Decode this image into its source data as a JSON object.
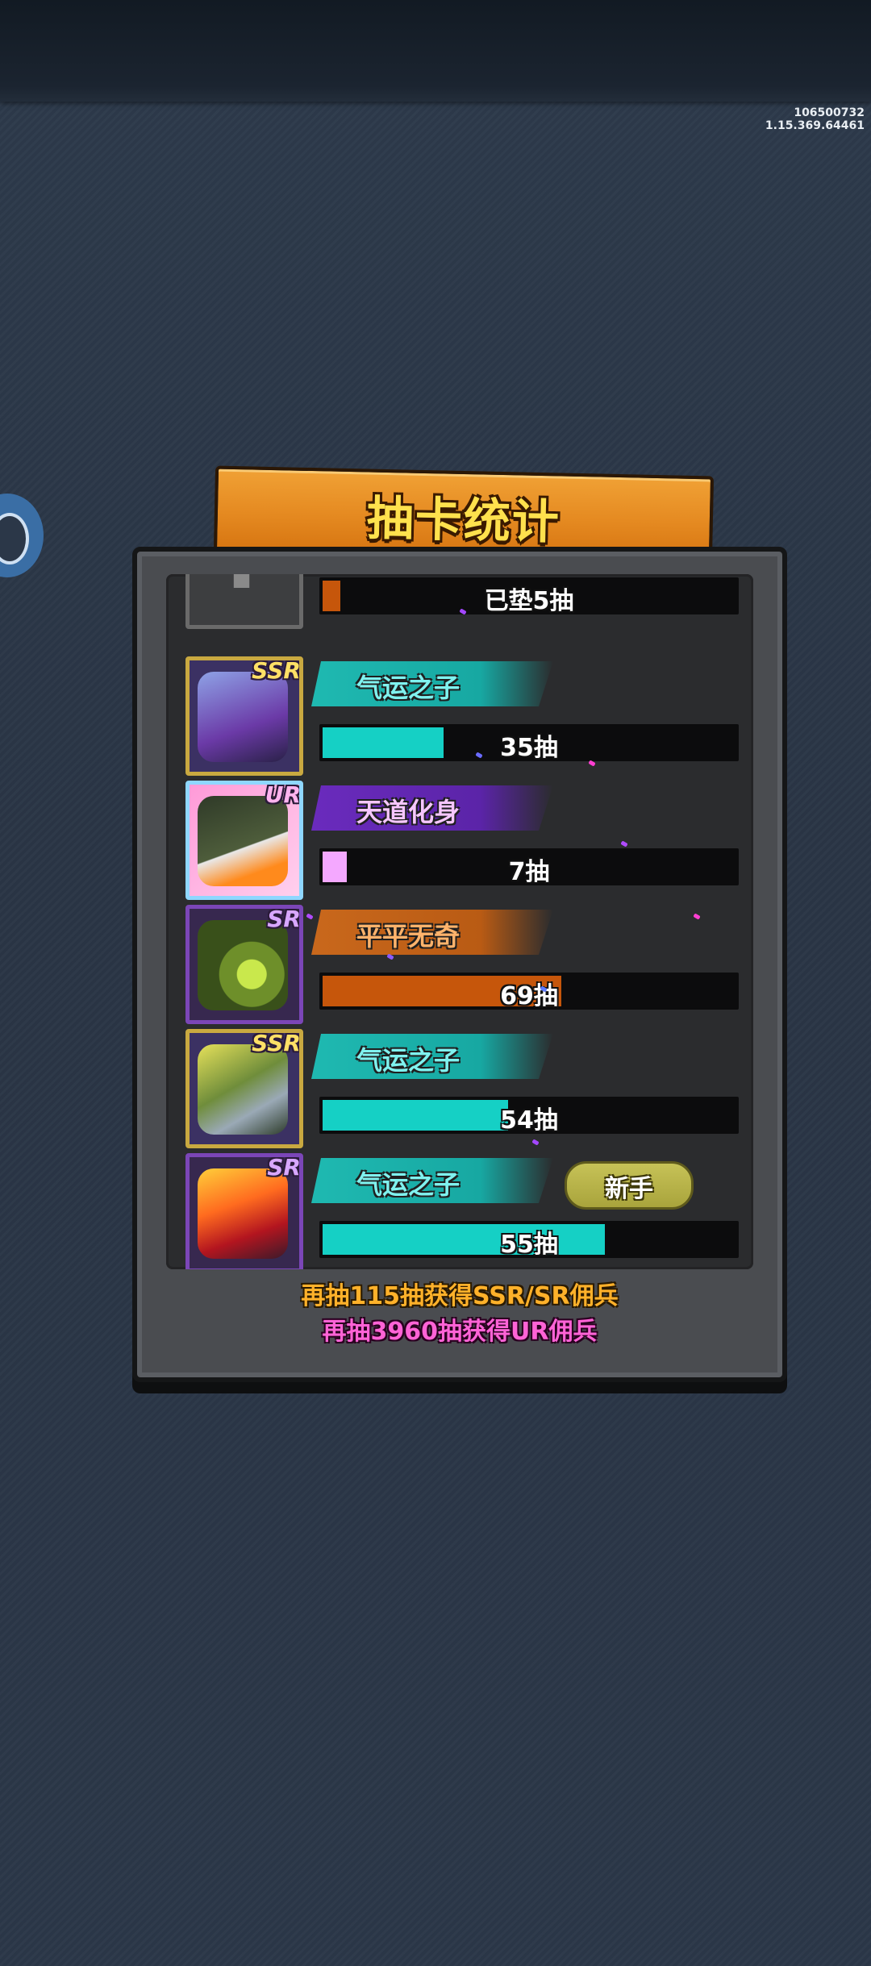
{
  "version": {
    "build": "106500732",
    "client": "1.15.369.64461"
  },
  "title": "抽卡统计",
  "rows": [
    {
      "rarity": "",
      "tag": "",
      "count_text": "已垫5抽",
      "progress": 0.05
    },
    {
      "rarity": "SSR",
      "tag": "气运之子",
      "count_text": "35抽",
      "progress": 0.3
    },
    {
      "rarity": "UR",
      "tag": "天道化身",
      "count_text": "7抽",
      "progress": 0.06
    },
    {
      "rarity": "SR",
      "tag": "平平无奇",
      "count_text": "69抽",
      "progress": 0.58
    },
    {
      "rarity": "SSR",
      "tag": "气运之子",
      "count_text": "54抽",
      "progress": 0.45
    },
    {
      "rarity": "SR",
      "tag": "气运之子",
      "badge": "新手",
      "count_text": "55抽",
      "progress": 0.68
    }
  ],
  "footer": {
    "line1": "再抽115抽获得SSR/SR佣兵",
    "line2": "再抽3960抽获得UR佣兵"
  },
  "colors": {
    "accent_cyan": "#15d0c5",
    "accent_pink": "#f4a8ff",
    "accent_orange": "#c6560b",
    "footer_gold": "#ffb12a",
    "footer_pink": "#ff63d6"
  }
}
